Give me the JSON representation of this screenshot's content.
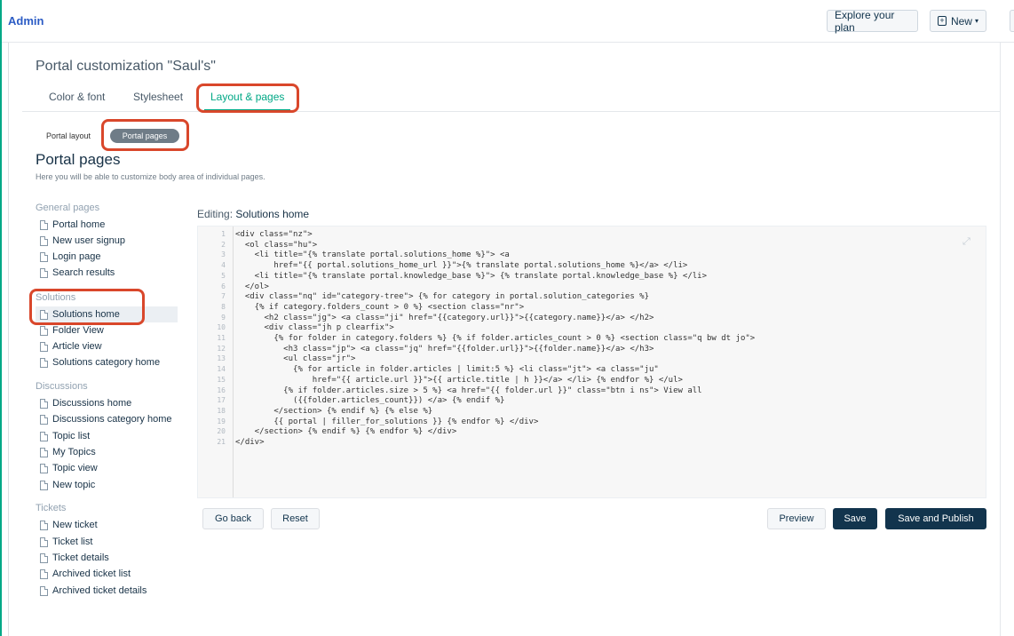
{
  "topbar": {
    "brand": "Admin",
    "explore_label": "Explore your plan",
    "new_label": "New"
  },
  "page_title": "Portal customization \"Saul's\"",
  "tabs": [
    {
      "label": "Color & font"
    },
    {
      "label": "Stylesheet"
    },
    {
      "label": "Layout & pages"
    }
  ],
  "subtabs": [
    {
      "label": "Portal layout"
    },
    {
      "label": "Portal pages"
    }
  ],
  "section": {
    "title": "Portal pages",
    "description": "Here you will be able to customize body area of individual pages."
  },
  "sidebar": {
    "groups": [
      {
        "title": "General pages",
        "items": [
          "Portal home",
          "New user signup",
          "Login page",
          "Search results"
        ]
      },
      {
        "title": "Solutions",
        "items": [
          "Solutions home",
          "Folder View",
          "Article view",
          "Solutions category home"
        ]
      },
      {
        "title": "Discussions",
        "items": [
          "Discussions home",
          "Discussions category home",
          "Topic list",
          "My Topics",
          "Topic view",
          "New topic"
        ]
      },
      {
        "title": "Tickets",
        "items": [
          "New ticket",
          "Ticket list",
          "Ticket details",
          "Archived ticket list",
          "Archived ticket details"
        ]
      }
    ],
    "active_item": "Solutions home"
  },
  "editor": {
    "editing_label": "Editing:",
    "editing_name": "Solutions home",
    "lines": [
      "<div class=\"nz\">",
      "  <ol class=\"hu\">",
      "    <li title=\"{% translate portal.solutions_home %}\"> <a",
      "        href=\"{{ portal.solutions_home_url }}\">{% translate portal.solutions_home %}</a> </li>",
      "    <li title=\"{% translate portal.knowledge_base %}\"> {% translate portal.knowledge_base %} </li>",
      "  </ol>",
      "  <div class=\"nq\" id=\"category-tree\"> {% for category in portal.solution_categories %}",
      "    {% if category.folders_count > 0 %} <section class=\"nr\">",
      "      <h2 class=\"jg\"> <a class=\"ji\" href=\"{{category.url}}\">{{category.name}}</a> </h2>",
      "      <div class=\"jh p clearfix\">",
      "        {% for folder in category.folders %} {% if folder.articles_count > 0 %} <section class=\"q bw dt jo\">",
      "          <h3 class=\"jp\"> <a class=\"jq\" href=\"{{folder.url}}\">{{folder.name}}</a> </h3>",
      "          <ul class=\"jr\">",
      "            {% for article in folder.articles | limit:5 %} <li class=\"jt\"> <a class=\"ju\"",
      "                href=\"{{ article.url }}\">{{ article.title | h }}</a> </li> {% endfor %} </ul>",
      "          {% if folder.articles.size > 5 %} <a href=\"{{ folder.url }}\" class=\"btn i ns\"> View all",
      "            ({{folder.articles_count}}) </a> {% endif %}",
      "        </section> {% endif %} {% else %}",
      "        {{ portal | filler_for_solutions }} {% endfor %} </div>",
      "    </section> {% endif %} {% endfor %} </div>",
      "</div>"
    ]
  },
  "footer": {
    "go_back": "Go back",
    "reset": "Reset",
    "preview": "Preview",
    "save": "Save",
    "save_publish": "Save and Publish"
  },
  "colors": {
    "accent": "#00a886",
    "primary_button": "#12344d",
    "highlight": "#d9472b"
  }
}
